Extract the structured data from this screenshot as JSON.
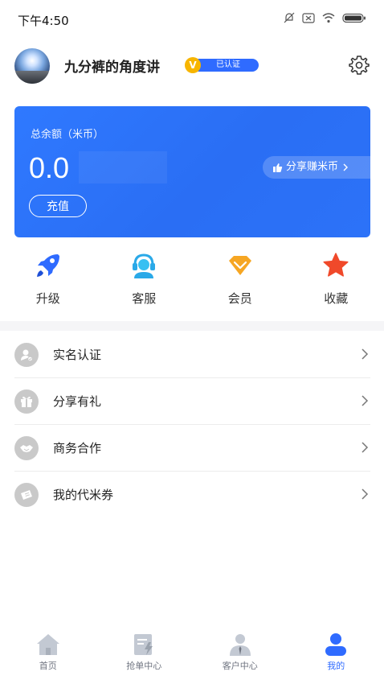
{
  "status_bar": {
    "time": "下午4:50"
  },
  "profile": {
    "username": "九分裤的角度讲",
    "badge_letter": "V",
    "badge_text": "已认证"
  },
  "balance": {
    "label": "总余额（米币）",
    "amount": "0.0",
    "recharge_label": "充值",
    "share_label": "分享赚米币"
  },
  "quick_actions": [
    {
      "label": "升级",
      "icon": "rocket-icon"
    },
    {
      "label": "客服",
      "icon": "headset-icon"
    },
    {
      "label": "会员",
      "icon": "vip-diamond-icon"
    },
    {
      "label": "收藏",
      "icon": "star-icon"
    }
  ],
  "menu": [
    {
      "label": "实名认证",
      "icon": "id-verify-icon"
    },
    {
      "label": "分享有礼",
      "icon": "gift-icon"
    },
    {
      "label": "商务合作",
      "icon": "handshake-icon"
    },
    {
      "label": "我的代米券",
      "icon": "coupon-icon"
    }
  ],
  "tabs": [
    {
      "label": "首页",
      "icon": "home-icon"
    },
    {
      "label": "抢单中心",
      "icon": "grab-order-icon"
    },
    {
      "label": "客户中心",
      "icon": "customer-icon"
    },
    {
      "label": "我的",
      "icon": "user-icon",
      "active": true
    }
  ],
  "colors": {
    "accent": "#2f6bff",
    "card": "#2a6ef4",
    "badge_gold": "#f7b500"
  }
}
